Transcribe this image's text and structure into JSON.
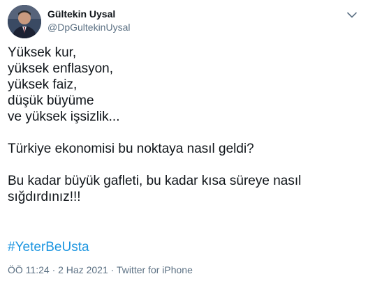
{
  "author": {
    "display_name": "Gültekin Uysal",
    "handle": "@DpGultekinUysal"
  },
  "tweet": {
    "lines": [
      "Yüksek kur,",
      "yüksek enflasyon,",
      "yüksek faiz,",
      "düşük büyüme",
      "ve yüksek işsizlik..."
    ],
    "paragraph2": "Türkiye ekonomisi bu noktaya nasıl geldi?",
    "paragraph3_line1": "Bu kadar büyük gafleti, bu kadar kısa süreye nasıl",
    "paragraph3_line2": "sığdırdınız!!!",
    "hashtag": "#YeterBeUsta"
  },
  "meta": {
    "time": "ÖÖ 11:24",
    "separator": "·",
    "date": "2 Haz 2021",
    "source": "Twitter for iPhone"
  },
  "icons": {
    "more": "chevron-down-icon",
    "avatar": "avatar"
  },
  "colors": {
    "text": "#0f1419",
    "secondary": "#5b7083",
    "hashtag": "#1b95e0"
  }
}
